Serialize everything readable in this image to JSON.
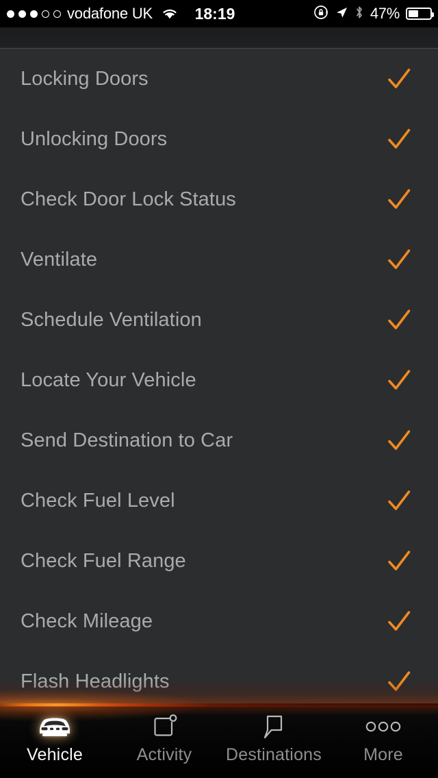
{
  "status_bar": {
    "signal_dots_total": 5,
    "signal_dots_filled": 3,
    "carrier": "vodafone UK",
    "wifi_icon": "wifi-icon",
    "time": "18:19",
    "rotation_lock_icon": "rotation-lock-icon",
    "location_icon": "location-arrow-icon",
    "bluetooth_icon": "bluetooth-icon",
    "battery_percent_label": "47%",
    "battery_level": 47
  },
  "colors": {
    "accent_orange": "#f08a22",
    "list_background": "#2c2d2f",
    "list_text": "#a9abac",
    "tab_active_text": "#f6f6f6",
    "tab_inactive_text": "#8e8f90",
    "glow_line": "#ff9a2e"
  },
  "list": {
    "items": [
      {
        "label": "Locking Doors",
        "checked": true,
        "check_glyph": "✓"
      },
      {
        "label": "Unlocking Doors",
        "checked": true,
        "check_glyph": "✓"
      },
      {
        "label": "Check Door Lock Status",
        "checked": true,
        "check_glyph": "✓"
      },
      {
        "label": "Ventilate",
        "checked": true,
        "check_glyph": "✓"
      },
      {
        "label": "Schedule Ventilation",
        "checked": true,
        "check_glyph": "✓"
      },
      {
        "label": "Locate Your Vehicle",
        "checked": true,
        "check_glyph": "✓"
      },
      {
        "label": "Send Destination to Car",
        "checked": true,
        "check_glyph": "✓"
      },
      {
        "label": "Check Fuel Level",
        "checked": true,
        "check_glyph": "✓"
      },
      {
        "label": "Check Fuel Range",
        "checked": true,
        "check_glyph": "✓"
      },
      {
        "label": "Check Mileage",
        "checked": true,
        "check_glyph": "✓"
      },
      {
        "label": "Flash Headlights",
        "checked": true,
        "check_glyph": "✓"
      }
    ]
  },
  "tab_bar": {
    "tabs": [
      {
        "label": "Vehicle",
        "icon": "car-front-icon",
        "active": true
      },
      {
        "label": "Activity",
        "icon": "square-badge-icon",
        "active": false
      },
      {
        "label": "Destinations",
        "icon": "map-pin-icon",
        "active": false
      },
      {
        "label": "More",
        "icon": "three-circles-icon",
        "active": false
      }
    ]
  }
}
